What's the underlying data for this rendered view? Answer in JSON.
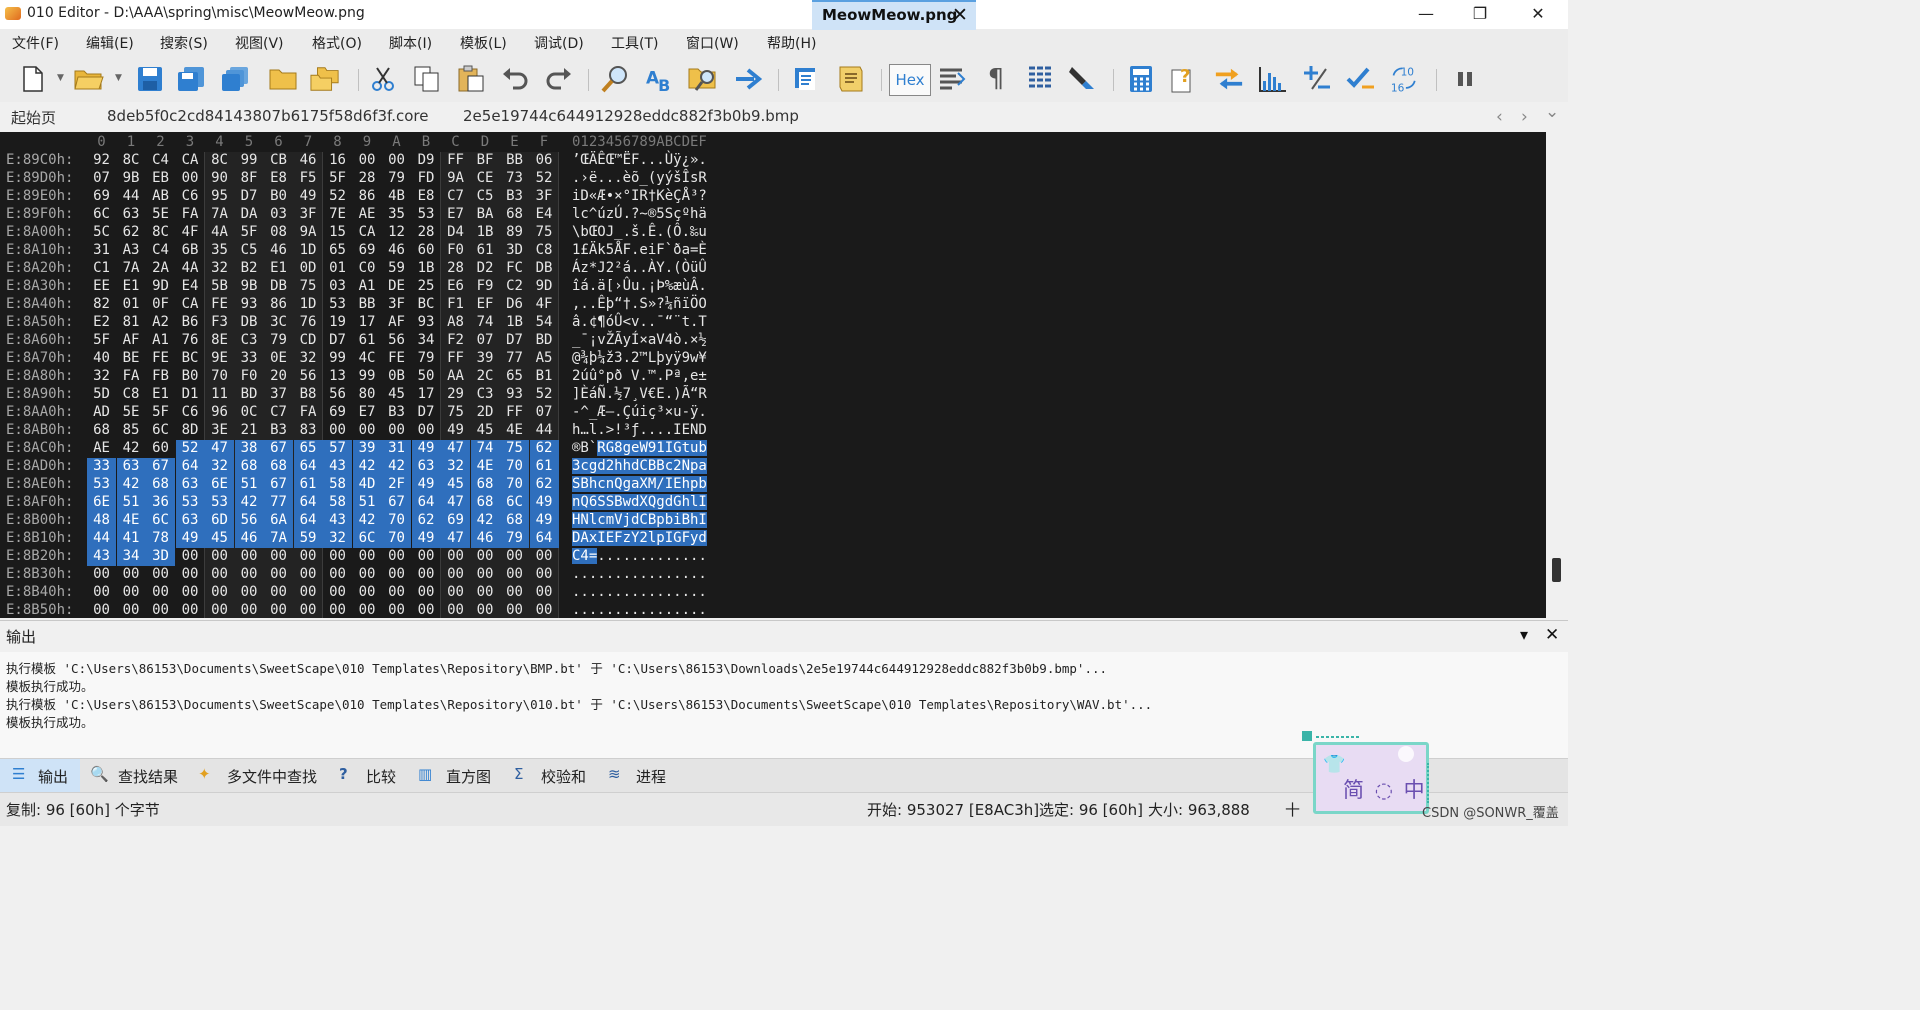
{
  "window": {
    "title": "010 Editor - D:\\AAA\\spring\\misc\\MeowMeow.png",
    "minimize": "—",
    "maximize": "❐",
    "close": "✕"
  },
  "menu": [
    "文件(F)",
    "编辑(E)",
    "搜索(S)",
    "视图(V)",
    "格式(O)",
    "脚本(I)",
    "模板(L)",
    "调试(D)",
    "工具(T)",
    "窗口(W)",
    "帮助(H)"
  ],
  "toolbar": {
    "hex_label": "Hex",
    "icons": [
      "new-file-icon",
      "open-file-icon",
      "save-icon",
      "save-as-icon",
      "save-all-icon",
      "open-folder-icon",
      "workspace-icon",
      "cut-icon",
      "copy-icon",
      "paste-icon",
      "undo-icon",
      "redo-icon",
      "find-icon",
      "find-replace-icon",
      "find-in-files-icon",
      "goto-icon",
      "run-script-icon",
      "run-template-icon",
      "hex-mode-icon",
      "wrap-icon",
      "paragraph-icon",
      "columns-icon",
      "highlight-icon",
      "calculator-icon",
      "inspector-icon",
      "compare-icon",
      "histogram-icon",
      "checksum-icon",
      "convert-icon",
      "base-convert-icon",
      "pause-icon"
    ]
  },
  "tabs": {
    "items": [
      "起始页",
      "8deb5f0c2cd84143807b6175f58d6f3f.core",
      "2e5e19744c644912928eddc882f3b0b9.bmp"
    ],
    "active": "MeowMeow.png",
    "close": "✕",
    "nav_left": "‹",
    "nav_right": "›",
    "nav_menu": "⌄"
  },
  "hex": {
    "columns": [
      "0",
      "1",
      "2",
      "3",
      "4",
      "5",
      "6",
      "7",
      "8",
      "9",
      "A",
      "B",
      "C",
      "D",
      "E",
      "F"
    ],
    "ascii_header": "0123456789ABCDEF",
    "rows": [
      {
        "addr": "E:89C0h:",
        "bytes": [
          "92",
          "8C",
          "C4",
          "CA",
          "8C",
          "99",
          "CB",
          "46",
          "16",
          "00",
          "00",
          "D9",
          "FF",
          "BF",
          "BB",
          "06"
        ],
        "ascii": "’ŒÄÊŒ™ËF...Ùÿ¿»."
      },
      {
        "addr": "E:89D0h:",
        "bytes": [
          "07",
          "9B",
          "EB",
          "00",
          "90",
          "8F",
          "E8",
          "F5",
          "5F",
          "28",
          "79",
          "FD",
          "9A",
          "CE",
          "73",
          "52"
        ],
        "ascii": ".›ë...èõ_(yýšÎsR"
      },
      {
        "addr": "E:89E0h:",
        "bytes": [
          "69",
          "44",
          "AB",
          "C6",
          "95",
          "D7",
          "B0",
          "49",
          "52",
          "86",
          "4B",
          "E8",
          "C7",
          "C5",
          "B3",
          "3F"
        ],
        "ascii": "iD«Æ•×°IR†KèÇÅ³?"
      },
      {
        "addr": "E:89F0h:",
        "bytes": [
          "6C",
          "63",
          "5E",
          "FA",
          "7A",
          "DA",
          "03",
          "3F",
          "7E",
          "AE",
          "35",
          "53",
          "E7",
          "BA",
          "68",
          "E4"
        ],
        "ascii": "lc^úzÚ.?~®5Sçºhä"
      },
      {
        "addr": "E:8A00h:",
        "bytes": [
          "5C",
          "62",
          "8C",
          "4F",
          "4A",
          "5F",
          "08",
          "9A",
          "15",
          "CA",
          "12",
          "28",
          "D4",
          "1B",
          "89",
          "75"
        ],
        "ascii": "\\bŒOJ_.š.Ê.(Ô.‰u"
      },
      {
        "addr": "E:8A10h:",
        "bytes": [
          "31",
          "A3",
          "C4",
          "6B",
          "35",
          "C5",
          "46",
          "1D",
          "65",
          "69",
          "46",
          "60",
          "F0",
          "61",
          "3D",
          "C8"
        ],
        "ascii": "1£Äk5ÅF.eiF`ða=È"
      },
      {
        "addr": "E:8A20h:",
        "bytes": [
          "C1",
          "7A",
          "2A",
          "4A",
          "32",
          "B2",
          "E1",
          "0D",
          "01",
          "C0",
          "59",
          "1B",
          "28",
          "D2",
          "FC",
          "DB"
        ],
        "ascii": "Áz*J2²á..ÀY.(ÒüÛ"
      },
      {
        "addr": "E:8A30h:",
        "bytes": [
          "EE",
          "E1",
          "9D",
          "E4",
          "5B",
          "9B",
          "DB",
          "75",
          "03",
          "A1",
          "DE",
          "25",
          "E6",
          "F9",
          "C2",
          "9D"
        ],
        "ascii": "îá.ä[›Ûu.¡Þ%æùÂ."
      },
      {
        "addr": "E:8A40h:",
        "bytes": [
          "82",
          "01",
          "0F",
          "CA",
          "FE",
          "93",
          "86",
          "1D",
          "53",
          "BB",
          "3F",
          "BC",
          "F1",
          "EF",
          "D6",
          "4F"
        ],
        "ascii": "‚..Êþ“†.S»?¼ñïÖO"
      },
      {
        "addr": "E:8A50h:",
        "bytes": [
          "E2",
          "81",
          "A2",
          "B6",
          "F3",
          "DB",
          "3C",
          "76",
          "19",
          "17",
          "AF",
          "93",
          "A8",
          "74",
          "1B",
          "54"
        ],
        "ascii": "â.¢¶óÛ<v..¯“¨t.T"
      },
      {
        "addr": "E:8A60h:",
        "bytes": [
          "5F",
          "AF",
          "A1",
          "76",
          "8E",
          "C3",
          "79",
          "CD",
          "D7",
          "61",
          "56",
          "34",
          "F2",
          "07",
          "D7",
          "BD"
        ],
        "ascii": "_¯¡vŽÃyÍ×aV4ò.×½"
      },
      {
        "addr": "E:8A70h:",
        "bytes": [
          "40",
          "BE",
          "FE",
          "BC",
          "9E",
          "33",
          "0E",
          "32",
          "99",
          "4C",
          "FE",
          "79",
          "FF",
          "39",
          "77",
          "A5"
        ],
        "ascii": "@¾þ¼ž3.2™Lþyÿ9w¥"
      },
      {
        "addr": "E:8A80h:",
        "bytes": [
          "32",
          "FA",
          "FB",
          "B0",
          "70",
          "F0",
          "20",
          "56",
          "13",
          "99",
          "0B",
          "50",
          "AA",
          "2C",
          "65",
          "B1"
        ],
        "ascii": "2úû°pð V.™.Pª,e±"
      },
      {
        "addr": "E:8A90h:",
        "bytes": [
          "5D",
          "C8",
          "E1",
          "D1",
          "11",
          "BD",
          "37",
          "B8",
          "56",
          "80",
          "45",
          "17",
          "29",
          "C3",
          "93",
          "52"
        ],
        "ascii": "]ÈáÑ.½7¸V€E.)Ã“R"
      },
      {
        "addr": "E:8AA0h:",
        "bytes": [
          "AD",
          "5E",
          "5F",
          "C6",
          "96",
          "0C",
          "C7",
          "FA",
          "69",
          "E7",
          "B3",
          "D7",
          "75",
          "2D",
          "FF",
          "07"
        ],
        "ascii": "-^_Æ–.Çúiç³×u-ÿ."
      },
      {
        "addr": "E:8AB0h:",
        "bytes": [
          "68",
          "85",
          "6C",
          "8D",
          "3E",
          "21",
          "B3",
          "83",
          "00",
          "00",
          "00",
          "00",
          "49",
          "45",
          "4E",
          "44"
        ],
        "ascii": "h…l.>!³ƒ....IEND"
      },
      {
        "addr": "E:8AC0h:",
        "bytes": [
          "AE",
          "42",
          "60",
          "52",
          "47",
          "38",
          "67",
          "65",
          "57",
          "39",
          "31",
          "49",
          "47",
          "74",
          "75",
          "62"
        ],
        "ascii": "®B`RG8geW91IGtub",
        "sel_from": 3
      },
      {
        "addr": "E:8AD0h:",
        "bytes": [
          "33",
          "63",
          "67",
          "64",
          "32",
          "68",
          "68",
          "64",
          "43",
          "42",
          "42",
          "63",
          "32",
          "4E",
          "70",
          "61"
        ],
        "ascii": "3cgd2hhdCBBc2Npa",
        "sel_from": 0
      },
      {
        "addr": "E:8AE0h:",
        "bytes": [
          "53",
          "42",
          "68",
          "63",
          "6E",
          "51",
          "67",
          "61",
          "58",
          "4D",
          "2F",
          "49",
          "45",
          "68",
          "70",
          "62"
        ],
        "ascii": "SBhcnQgaXM/IEhpb",
        "sel_from": 0
      },
      {
        "addr": "E:8AF0h:",
        "bytes": [
          "6E",
          "51",
          "36",
          "53",
          "53",
          "42",
          "77",
          "64",
          "58",
          "51",
          "67",
          "64",
          "47",
          "68",
          "6C",
          "49"
        ],
        "ascii": "nQ6SSBwdXQgdGhlI",
        "sel_from": 0
      },
      {
        "addr": "E:8B00h:",
        "bytes": [
          "48",
          "4E",
          "6C",
          "63",
          "6D",
          "56",
          "6A",
          "64",
          "43",
          "42",
          "70",
          "62",
          "69",
          "42",
          "68",
          "49"
        ],
        "ascii": "HNlcmVjdCBpbiBhI",
        "sel_from": 0
      },
      {
        "addr": "E:8B10h:",
        "bytes": [
          "44",
          "41",
          "78",
          "49",
          "45",
          "46",
          "7A",
          "59",
          "32",
          "6C",
          "70",
          "49",
          "47",
          "46",
          "79",
          "64"
        ],
        "ascii": "DAxIEFzY2lpIGFyd",
        "sel_from": 0
      },
      {
        "addr": "E:8B20h:",
        "bytes": [
          "43",
          "34",
          "3D",
          "00",
          "00",
          "00",
          "00",
          "00",
          "00",
          "00",
          "00",
          "00",
          "00",
          "00",
          "00",
          "00"
        ],
        "ascii": "C4=.............",
        "sel_from": 0,
        "sel_to": 2
      },
      {
        "addr": "E:8B30h:",
        "bytes": [
          "00",
          "00",
          "00",
          "00",
          "00",
          "00",
          "00",
          "00",
          "00",
          "00",
          "00",
          "00",
          "00",
          "00",
          "00",
          "00"
        ],
        "ascii": "................"
      },
      {
        "addr": "E:8B40h:",
        "bytes": [
          "00",
          "00",
          "00",
          "00",
          "00",
          "00",
          "00",
          "00",
          "00",
          "00",
          "00",
          "00",
          "00",
          "00",
          "00",
          "00"
        ],
        "ascii": "................"
      },
      {
        "addr": "E:8B50h:",
        "bytes": [
          "00",
          "00",
          "00",
          "00",
          "00",
          "00",
          "00",
          "00",
          "00",
          "00",
          "00",
          "00",
          "00",
          "00",
          "00",
          "00"
        ],
        "ascii": "................"
      }
    ]
  },
  "output": {
    "title": "输出",
    "collapse": "▾",
    "close": "✕",
    "lines": [
      "执行模板 'C:\\Users\\86153\\Documents\\SweetScape\\010 Templates\\Repository\\BMP.bt' 于 'C:\\Users\\86153\\Downloads\\2e5e19744c644912928eddc882f3b0b9.bmp'...",
      "模板执行成功。",
      "执行模板 'C:\\Users\\86153\\Documents\\SweetScape\\010 Templates\\Repository\\010.bt' 于 'C:\\Users\\86153\\Documents\\SweetScape\\010 Templates\\Repository\\WAV.bt'...",
      "模板执行成功。"
    ]
  },
  "bottom_tabs": [
    "输出",
    "查找结果",
    "多文件中查找",
    "比较",
    "直方图",
    "校验和",
    "进程"
  ],
  "status": {
    "copy": "复制: 96 [60h] 个字节",
    "start": "开始: 953027 [E8AC3h]",
    "selected": "选定: 96 [60h]",
    "size": "大小: 963,888",
    "hex_label": "十",
    "watermark": "CSDN @SONWR_覆盖"
  },
  "ime": {
    "text": "简 ◌ 中",
    "shirt_icon": "👕"
  }
}
